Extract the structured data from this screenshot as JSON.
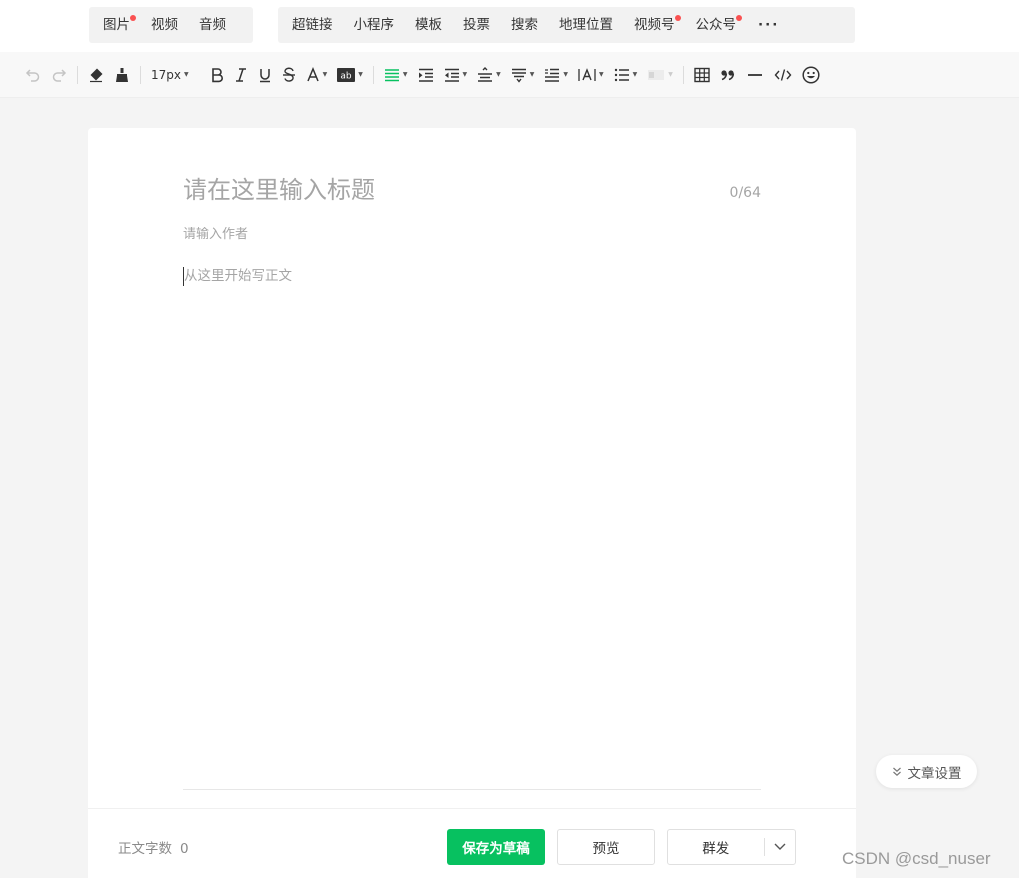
{
  "insert_tabs": {
    "group1": [
      {
        "label": "图片",
        "dot": true
      },
      {
        "label": "视频",
        "dot": false
      },
      {
        "label": "音频",
        "dot": false
      }
    ],
    "group2": [
      {
        "label": "超链接",
        "dot": false
      },
      {
        "label": "小程序",
        "dot": false
      },
      {
        "label": "模板",
        "dot": false
      },
      {
        "label": "投票",
        "dot": false
      },
      {
        "label": "搜索",
        "dot": false
      },
      {
        "label": "地理位置",
        "dot": false
      },
      {
        "label": "视频号",
        "dot": true
      },
      {
        "label": "公众号",
        "dot": true
      }
    ],
    "more_label": "···"
  },
  "toolbar": {
    "font_size": "17px",
    "accent_color": "#07c160",
    "icons": [
      "undo-icon",
      "redo-icon",
      "clear-format-icon",
      "format-painter-icon",
      "bold-icon",
      "italic-icon",
      "underline-icon",
      "strikethrough-icon",
      "font-color-icon",
      "background-color-icon",
      "align-icon",
      "indent-icon",
      "outdent-icon",
      "line-height-icon",
      "paragraph-spacing-icon",
      "first-line-indent-icon",
      "letter-spacing-icon",
      "list-icon",
      "table-icon",
      "quote-icon",
      "divider-icon",
      "code-icon",
      "emoji-icon"
    ]
  },
  "editor": {
    "title_placeholder": "请在这里输入标题",
    "title_count": "0/64",
    "author_placeholder": "请输入作者",
    "body_placeholder": "从这里开始写正文"
  },
  "footer": {
    "word_count_label": "正文字数",
    "word_count_value": "0",
    "save_label": "保存为草稿",
    "preview_label": "预览",
    "publish_label": "群发"
  },
  "side": {
    "settings_label": "文章设置"
  },
  "watermark": "CSDN @csd_nuser"
}
